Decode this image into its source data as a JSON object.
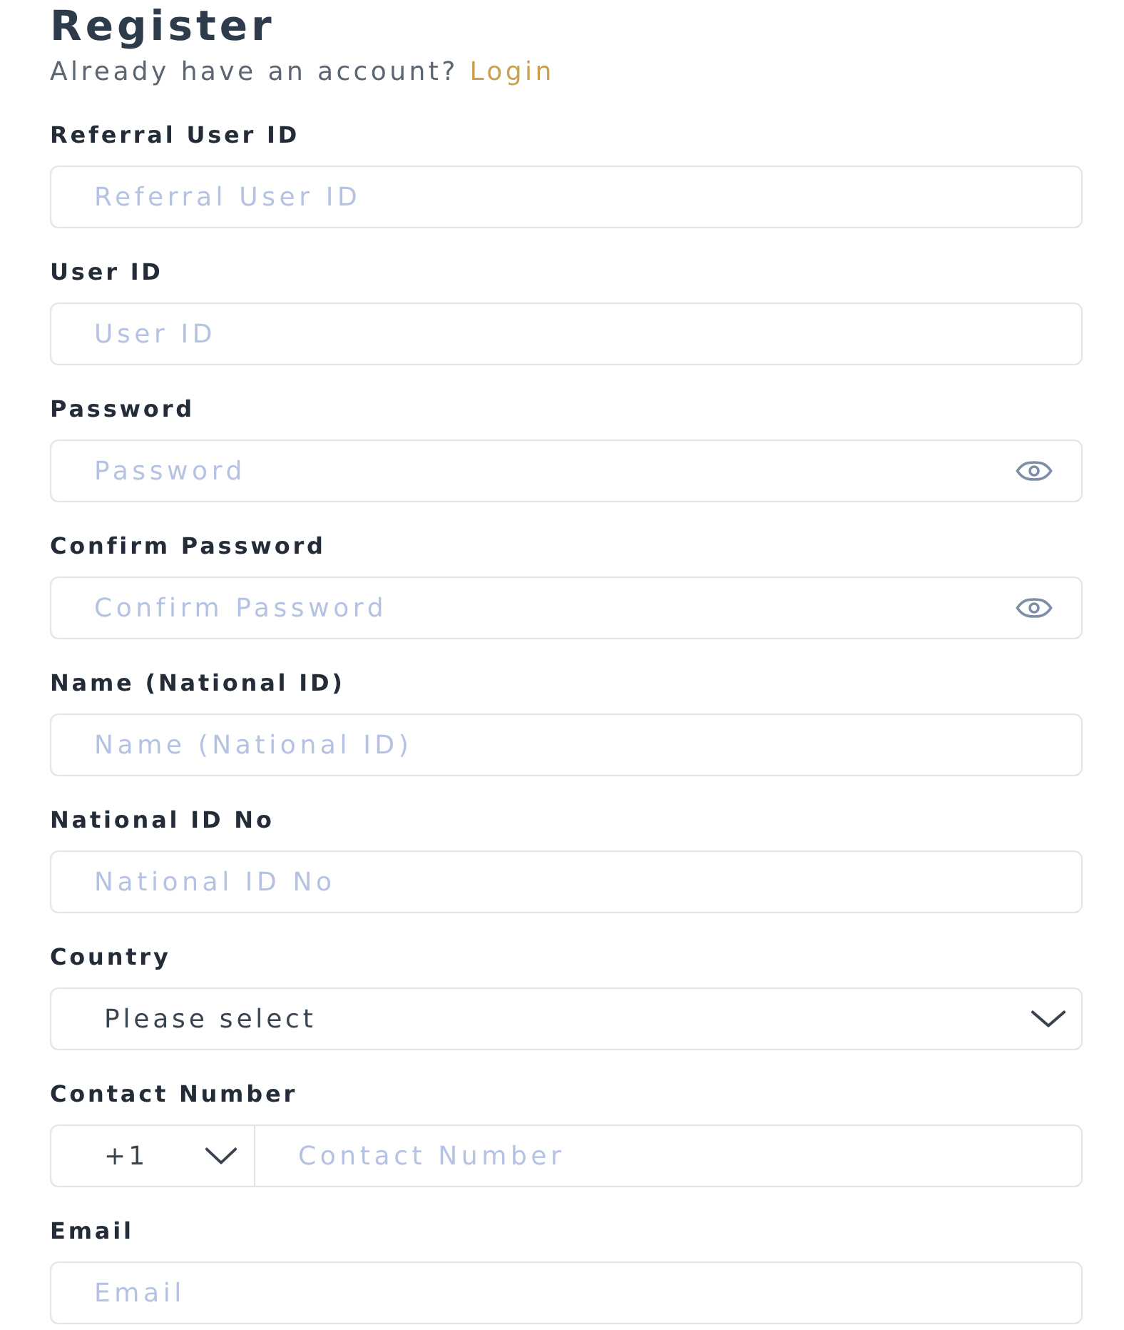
{
  "title": "Register",
  "login_prompt": {
    "text": "Already have an account?",
    "link": "Login"
  },
  "fields": [
    {
      "kind": "text",
      "label": "Referral User ID",
      "placeholder": "Referral User ID"
    },
    {
      "kind": "text",
      "label": "User ID",
      "placeholder": "User ID"
    },
    {
      "kind": "password",
      "label": "Password",
      "placeholder": "Password"
    },
    {
      "kind": "password",
      "label": "Confirm Password",
      "placeholder": "Confirm Password"
    },
    {
      "kind": "text",
      "label": "Name (National ID)",
      "placeholder": "Name (National ID)"
    },
    {
      "kind": "text",
      "label": "National ID No",
      "placeholder": "National ID No"
    },
    {
      "kind": "select",
      "label": "Country",
      "value": "Please select"
    },
    {
      "kind": "phone",
      "label": "Contact Number",
      "code": "+1",
      "placeholder": "Contact Number"
    },
    {
      "kind": "text",
      "label": "Email",
      "placeholder": "Email"
    }
  ]
}
